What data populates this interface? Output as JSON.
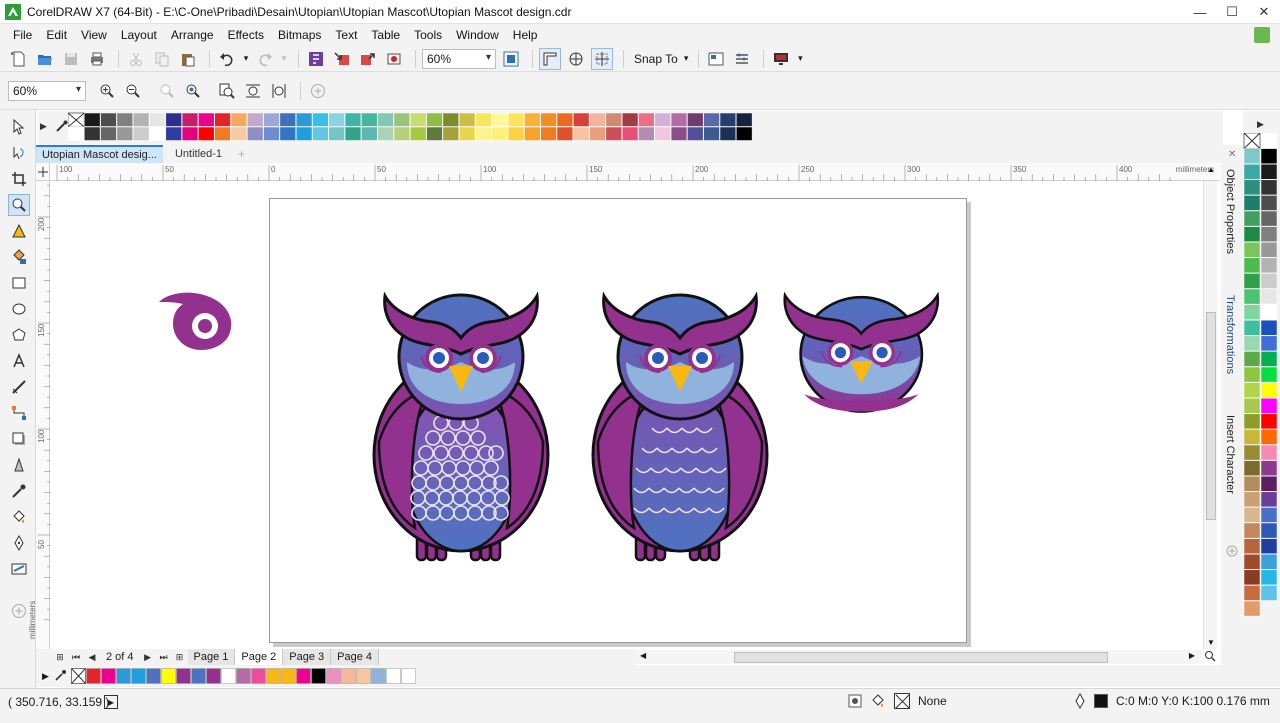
{
  "window": {
    "title": "CorelDRAW X7 (64-Bit) - E:\\C-One\\Pribadi\\Desain\\Utopian\\Utopian Mascot\\Utopian Mascot design.cdr",
    "minimize": "—",
    "maximize": "☐",
    "close": "✕"
  },
  "menu": {
    "items": [
      {
        "label": "File",
        "key": "F",
        "rest": "ile"
      },
      {
        "label": "Edit",
        "key": "E",
        "rest": "dit"
      },
      {
        "label": "View",
        "key": "V",
        "rest": "iew"
      },
      {
        "label": "Layout",
        "key": "L",
        "rest": "ayout"
      },
      {
        "label": "Arrange",
        "key": "A",
        "rest": "rrange"
      },
      {
        "label": "Effects",
        "key": "C",
        "rest": "Effe"
      },
      {
        "label": "Bitmaps",
        "key": "B",
        "rest": "itmaps"
      },
      {
        "label": "Text",
        "key": "T",
        "rest": "ext"
      },
      {
        "label": "Table",
        "key": "T",
        "rest": "able"
      },
      {
        "label": "Tools",
        "key": "o",
        "rest": "Tools"
      },
      {
        "label": "Window",
        "key": "W",
        "rest": "indow"
      },
      {
        "label": "Help",
        "key": "H",
        "rest": "elp"
      }
    ]
  },
  "toolbar": {
    "zoom_value": "60%",
    "snap_to": "Snap To"
  },
  "propbar": {
    "zoom_value": "60%"
  },
  "tabs": {
    "items": [
      {
        "label": "Utopian Mascot desig...",
        "active": true
      },
      {
        "label": "Untitled-1",
        "active": false
      }
    ],
    "add": "+"
  },
  "ruler": {
    "h_ticks": [
      {
        "label": "100",
        "value": -100
      },
      {
        "label": "50",
        "value": -50
      },
      {
        "label": "0",
        "value": 0
      },
      {
        "label": "50",
        "value": 50
      },
      {
        "label": "100",
        "value": 100
      },
      {
        "label": "150",
        "value": 150
      },
      {
        "label": "200",
        "value": 200
      },
      {
        "label": "250",
        "value": 250
      },
      {
        "label": "300",
        "value": 300
      },
      {
        "label": "350",
        "value": 350
      },
      {
        "label": "400",
        "value": 400
      }
    ],
    "v_ticks": [
      {
        "label": "200",
        "value": 200
      },
      {
        "label": "150",
        "value": 150
      },
      {
        "label": "100",
        "value": 100
      },
      {
        "label": "50",
        "value": 50
      }
    ],
    "unit": "millimeters"
  },
  "dockers": {
    "items": [
      "Object Properties",
      "Transformations",
      "Insert Character"
    ]
  },
  "pages": {
    "count_text": "2 of 4",
    "items": [
      {
        "label": "Page 1",
        "active": false
      },
      {
        "label": "Page 2",
        "active": true
      },
      {
        "label": "Page 3",
        "active": false
      },
      {
        "label": "Page 4",
        "active": false
      }
    ]
  },
  "status": {
    "coords": "( 350.716, 33.159 )",
    "fill_label": "None",
    "outline_text": "C:0 M:0 Y:0 K:100  0.176 mm"
  },
  "colors": {
    "owl_purple": "#93318e",
    "owl_blue": "#4d73c0",
    "owl_light_blue": "#8fb3dd",
    "beak_yellow": "#f8b712",
    "outline": "#111111"
  },
  "top_palette": [
    "#ffffff",
    "#1a1a1a",
    "#333333",
    "#4d4d4d",
    "#666666",
    "#808080",
    "#999999",
    "#b3b3b3",
    "#cccccc",
    "#e6e6e6",
    "#ffffff",
    "#2a2e8f",
    "#2c3fa0",
    "#c81e6a",
    "#e5007e",
    "#ec008c",
    "#ff0000",
    "#e4242b",
    "#f07b22",
    "#f9a85a",
    "#f7c9a4",
    "#c3a7cf",
    "#8f8fc8",
    "#9aa7d8",
    "#6c8ed0",
    "#3e6fb7",
    "#2f77c6",
    "#2a9bd6",
    "#1ea0df",
    "#36c1e6",
    "#62c6e5",
    "#8ad3e6",
    "#74c6c4",
    "#3fb3a6",
    "#2fa58f",
    "#46b59c",
    "#5db8b0",
    "#86c6b5",
    "#a8d3b6",
    "#9ac37c",
    "#b3d17a",
    "#c9dc70",
    "#a8c93f",
    "#8fbe45",
    "#5f7c3c",
    "#7c8b2c",
    "#a4a23a",
    "#c9c043",
    "#e6d74a",
    "#f6e659",
    "#fdf28c",
    "#fff89d",
    "#fff07a",
    "#fce35a",
    "#fcd23f",
    "#f9b236",
    "#f6a22d",
    "#f18f22",
    "#ee7d1f",
    "#ea6a24",
    "#e14f2c",
    "#d8403a",
    "#f5c5a3",
    "#f4b49d",
    "#e9a07a",
    "#d08a71",
    "#c8505a",
    "#a03a45",
    "#e94e77",
    "#ee6b8a",
    "#b48bb3",
    "#d6b0d4",
    "#f0c8dd",
    "#b46aa5",
    "#8c4e8a",
    "#6d3d72",
    "#4f4f9c",
    "#5b68a8",
    "#3d5a8e",
    "#243f6e",
    "#1c2f55",
    "#13233f",
    "#000000"
  ],
  "right_palette": [
    "#ffffff",
    "#7fc8c8",
    "#000000",
    "#3aa8a5",
    "#1a1a1a",
    "#2f8f7e",
    "#333333",
    "#1d7d6a",
    "#4d4d4d",
    "#40a060",
    "#666666",
    "#1e8a45",
    "#808080",
    "#7ac55e",
    "#999999",
    "#4dbb4d",
    "#b3b3b3",
    "#2ea04a",
    "#cccccc",
    "#4cc46f",
    "#e6e6e6",
    "#80d4a0",
    "#ffffff",
    "#3cbf9a",
    "#1c4fbe",
    "#9ad6b0",
    "#3f6fd2",
    "#5fa84a",
    "#00b050",
    "#8cc63f",
    "#00e040",
    "#b3d34a",
    "#ffff00",
    "#a7c94f",
    "#ff00ff",
    "#8c9d2a",
    "#ff0000",
    "#c7b83a",
    "#ff6a00",
    "#9a8b32",
    "#f58ab4",
    "#7c6a2f",
    "#8c3c8c",
    "#b38c5a",
    "#5b1f5f",
    "#cba074",
    "#6a3d98",
    "#d9b68c",
    "#4a6fc9",
    "#c4865a",
    "#2e58b8",
    "#b5663e",
    "#1e3fa0",
    "#a14b2c",
    "#3ca0dc",
    "#8a3b24",
    "#25b7e6",
    "#c86a3a",
    "#5ec3e9",
    "#e29a66"
  ],
  "doc_palette": [
    "#e4242b",
    "#ec008c",
    "#2a9bd6",
    "#1ea0df",
    "#4d73c0",
    "#ffff00",
    "#93318e",
    "#4d73c0",
    "#93318e",
    "#ffffff",
    "#b46aa5",
    "#ec4d9b",
    "#f8b712",
    "#f8b712",
    "#ec008c",
    "#000000",
    "#ee8fc0",
    "#f6b89a",
    "#f5c79a",
    "#8fb3dd",
    "#ffffff",
    "#ffffff"
  ]
}
